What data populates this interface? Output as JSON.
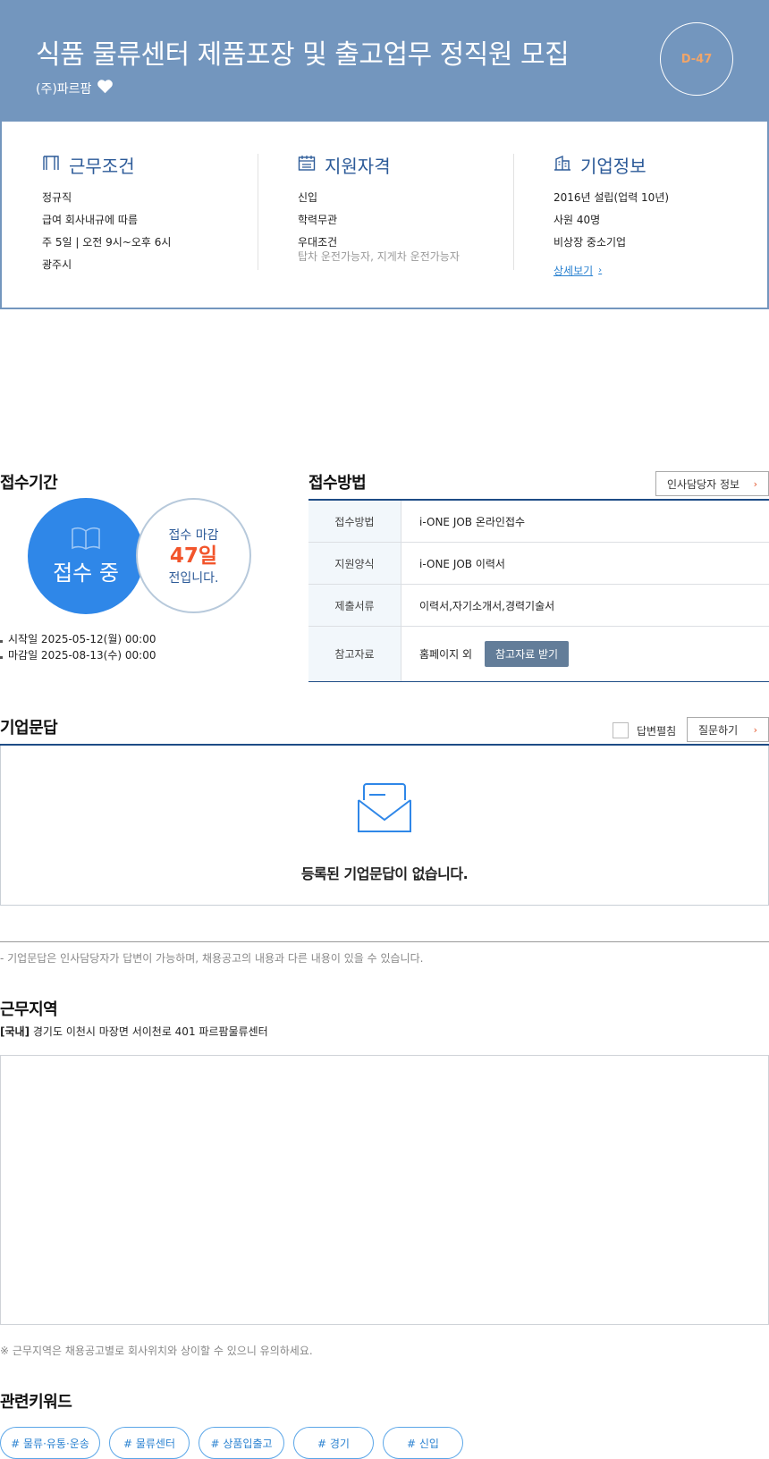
{
  "header": {
    "title": "식품 물류센터 제품포장 및 출고업무 정직원 모집",
    "company": "(주)파르팜",
    "dday": "D-47",
    "bg_color": "#7396be"
  },
  "summary": {
    "work": {
      "heading": "근무조건",
      "icon": "book-icon",
      "items": [
        "정규직",
        "급여 회사내규에 따름",
        "주 5일 | 오전 9시~오후 6시",
        "광주시"
      ]
    },
    "qualification": {
      "heading": "지원자격",
      "icon": "calendar-icon",
      "items": [
        "신입",
        "학력무관",
        "우대조건"
      ],
      "preferred": "탑차 운전가능자, 지게차 운전가능자"
    },
    "company": {
      "heading": "기업정보",
      "icon": "building-icon",
      "items": [
        "2016년 설립(업력 10년)",
        "사원 40명",
        "비상장 중소기업"
      ],
      "detail_link": "상세보기"
    }
  },
  "reception_period": {
    "title": "접수기간",
    "status": "접수 중",
    "deadline_prefix": "접수 마감",
    "days_left": "47일",
    "deadline_suffix": "전입니다.",
    "start": "시작일 2025-05-12(월) 00:00",
    "end": "마감일 2025-08-13(수) 00:00"
  },
  "reception_method": {
    "title": "접수방법",
    "hr_button": "인사담당자 정보",
    "rows": [
      {
        "label": "접수방법",
        "value": "i-ONE JOB 온라인접수"
      },
      {
        "label": "지원양식",
        "value": "i-ONE JOB 이력서"
      },
      {
        "label": "제출서류",
        "value": "이력서,자기소개서,경력기술서"
      },
      {
        "label": "참고자료",
        "value": "홈페이지 외",
        "button": "참고자료 받기"
      }
    ]
  },
  "qa": {
    "title": "기업문답",
    "expand_label": "답변펼침",
    "ask_button": "질문하기",
    "empty_message": "등록된 기업문답이 없습니다.",
    "note": "- 기업문답은 인사담당자가 답변이 가능하며, 채용공고의 내용과 다른 내용이 있을 수 있습니다."
  },
  "location": {
    "title": "근무지역",
    "region_tag": "[국내]",
    "address": "경기도 이천시 마장면 서이천로 401 파르팜물류센터",
    "note": "※ 근무지역은 채용공고별로 회사위치와 상이할 수 있으니 유의하세요."
  },
  "keywords": {
    "title": "관련키워드",
    "items": [
      "# 물류·유통·운송",
      "# 물류센터",
      "# 상품입출고",
      "# 경기",
      "# 신입"
    ]
  }
}
